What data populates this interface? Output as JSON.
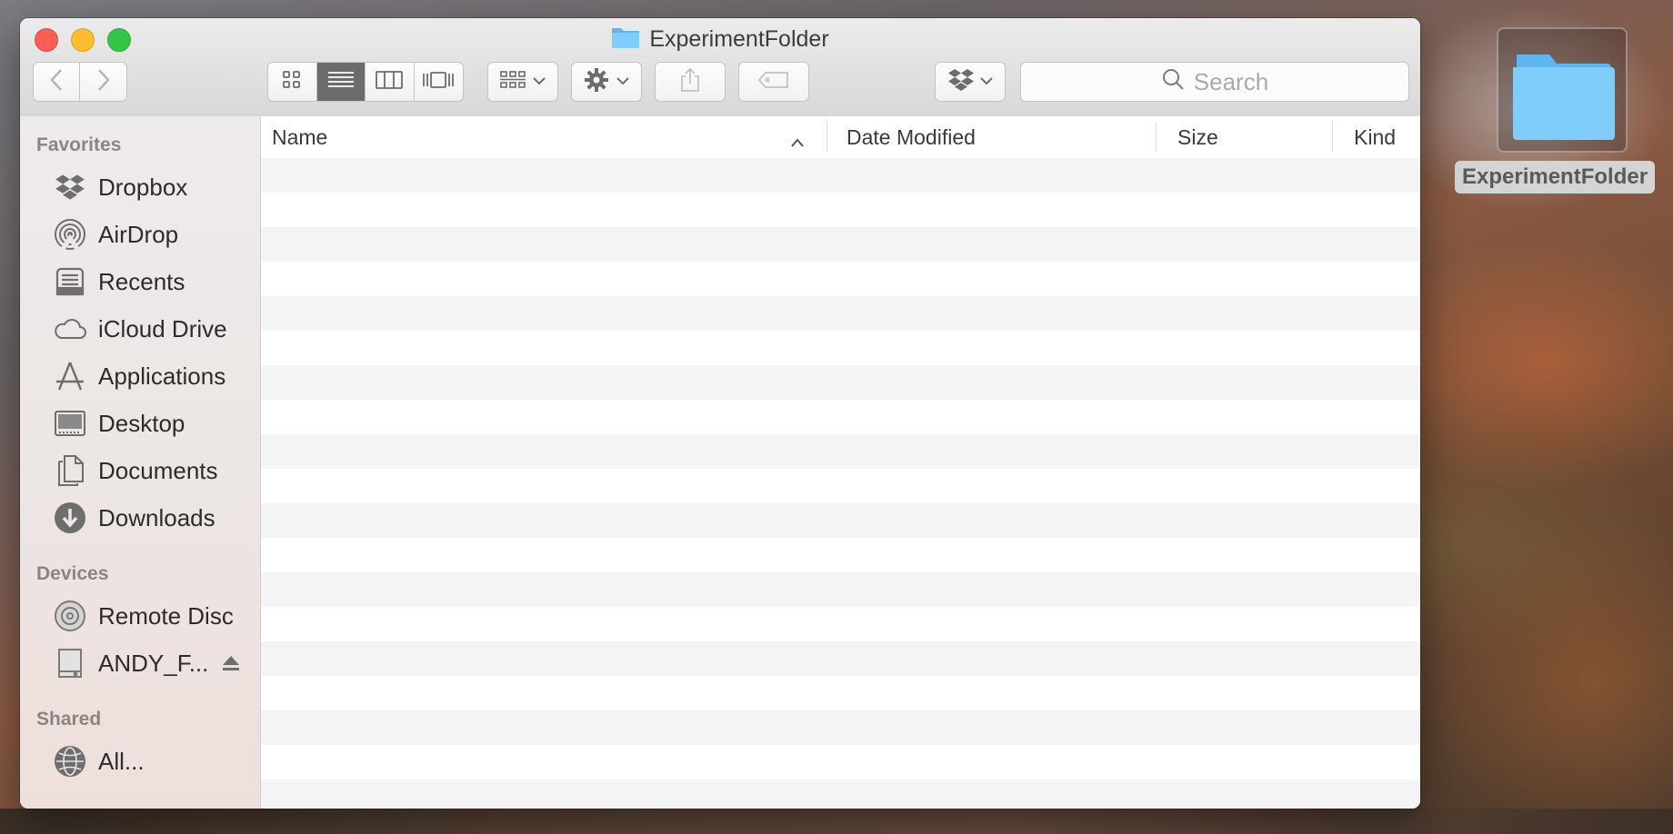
{
  "window": {
    "title": "ExperimentFolder"
  },
  "toolbar": {
    "back_icon": "chevron-left-icon",
    "forward_icon": "chevron-right-icon",
    "view_modes": [
      "icon-view",
      "list-view",
      "column-view",
      "cover-flow-view"
    ],
    "active_view": "list-view",
    "arrange_icon": "group-icon",
    "action_icon": "gear-icon",
    "share_icon": "share-icon",
    "tag_icon": "tag-icon",
    "dropbox_icon": "dropbox-icon",
    "search_placeholder": "Search"
  },
  "sidebar": {
    "sections": [
      {
        "heading": "Favorites",
        "items": [
          {
            "label": "Dropbox",
            "icon": "dropbox-icon"
          },
          {
            "label": "AirDrop",
            "icon": "airdrop-icon"
          },
          {
            "label": "Recents",
            "icon": "recents-icon"
          },
          {
            "label": "iCloud Drive",
            "icon": "cloud-icon"
          },
          {
            "label": "Applications",
            "icon": "applications-icon"
          },
          {
            "label": "Desktop",
            "icon": "desktop-icon"
          },
          {
            "label": "Documents",
            "icon": "documents-icon"
          },
          {
            "label": "Downloads",
            "icon": "downloads-icon"
          }
        ]
      },
      {
        "heading": "Devices",
        "items": [
          {
            "label": "Remote Disc",
            "icon": "disc-icon"
          },
          {
            "label": "ANDY_F...",
            "icon": "drive-icon"
          }
        ]
      },
      {
        "heading": "Shared",
        "items": [
          {
            "label": "All...",
            "icon": "network-icon"
          }
        ]
      }
    ]
  },
  "list": {
    "columns": [
      "Name",
      "Date Modified",
      "Size",
      "Kind"
    ],
    "sort_column": "Name",
    "sort_direction": "ascending",
    "rows": []
  },
  "desktop": {
    "folder_label": "ExperimentFolder"
  },
  "colors": {
    "folder_blue": "#6cc3f5",
    "close": "#fc5e57",
    "minimize": "#fdbc2e",
    "zoom": "#33c748"
  }
}
